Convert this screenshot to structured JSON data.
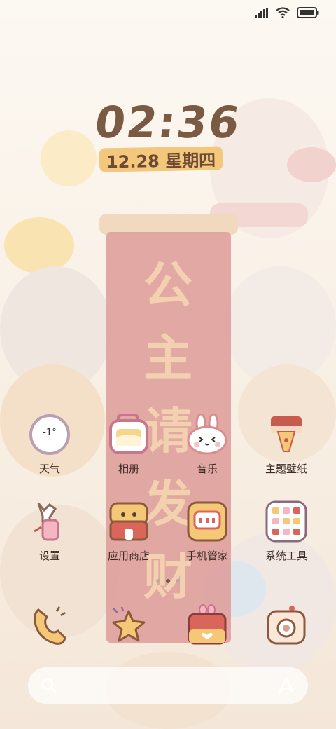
{
  "status_bar": {
    "signal_icon": "signal-icon",
    "wifi_icon": "wifi-icon",
    "battery_icon": "battery-icon"
  },
  "clock": {
    "time": "02:36",
    "date": "12.28 星期四"
  },
  "wallpaper": {
    "banner_text": "公主请发财",
    "colors": {
      "banner": "#d98a8a",
      "gold": "#f1c86e",
      "bg": "#fbf6ef"
    }
  },
  "apps": [
    {
      "label": "天气",
      "icon": "weather-icon",
      "temp": "-1°"
    },
    {
      "label": "相册",
      "icon": "gallery-icon"
    },
    {
      "label": "音乐",
      "icon": "music-icon"
    },
    {
      "label": "主题壁纸",
      "icon": "themes-icon"
    },
    {
      "label": "设置",
      "icon": "settings-icon"
    },
    {
      "label": "应用商店",
      "icon": "app-store-icon"
    },
    {
      "label": "手机管家",
      "icon": "security-icon"
    },
    {
      "label": "系统工具",
      "icon": "tools-folder-icon"
    }
  ],
  "page_indicator": {
    "count": 3,
    "active": 1
  },
  "dock": [
    {
      "icon": "phone-icon"
    },
    {
      "icon": "favorites-icon"
    },
    {
      "icon": "messages-icon"
    },
    {
      "icon": "camera-icon"
    }
  ],
  "search_bar": {
    "search_icon": "search-icon",
    "assistant_icon": "assistant-icon"
  }
}
